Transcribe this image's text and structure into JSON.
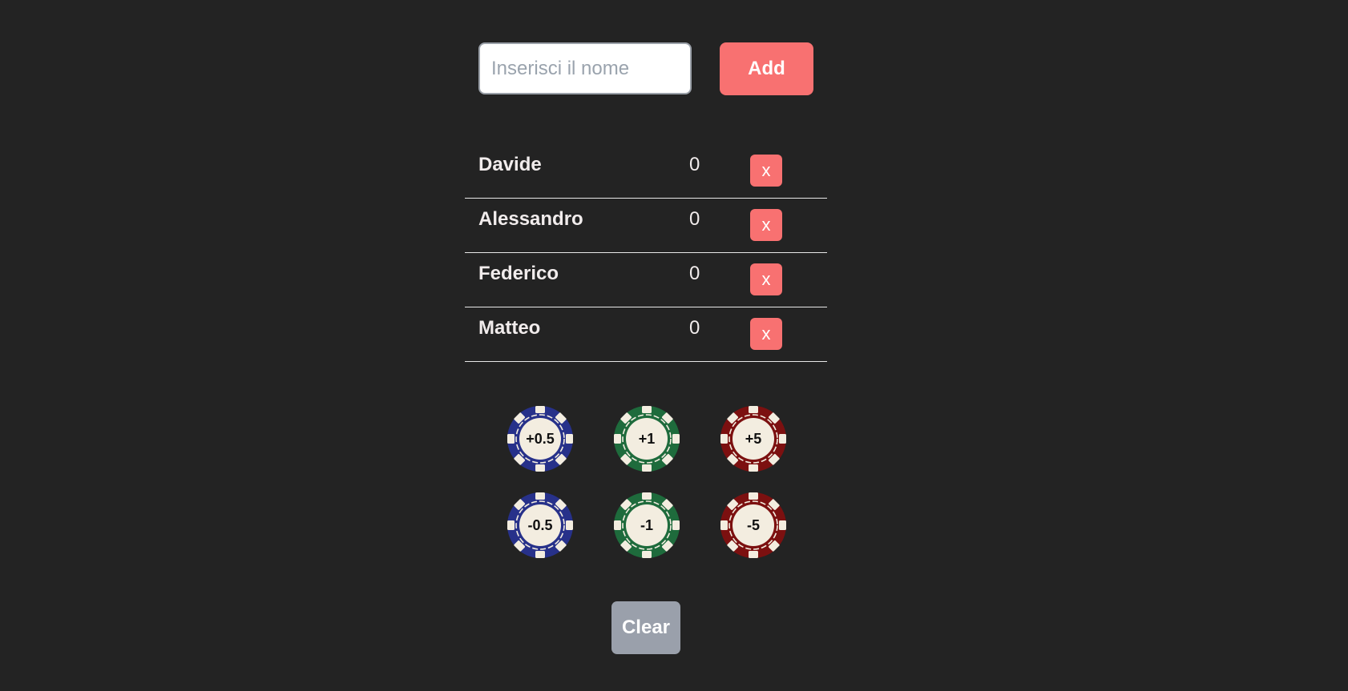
{
  "add_form": {
    "placeholder": "Inserisci il nome",
    "value": "",
    "add_label": "Add"
  },
  "players": [
    {
      "name": "Davide",
      "score": "0",
      "remove_label": "x"
    },
    {
      "name": "Alessandro",
      "score": "0",
      "remove_label": "x"
    },
    {
      "name": "Federico",
      "score": "0",
      "remove_label": "x"
    },
    {
      "name": "Matteo",
      "score": "0",
      "remove_label": "x"
    }
  ],
  "chips": [
    {
      "label": "+0.5",
      "color": "#27318a"
    },
    {
      "label": "+1",
      "color": "#1e6b3c"
    },
    {
      "label": "+5",
      "color": "#7c1010"
    },
    {
      "label": "-0.5",
      "color": "#27318a"
    },
    {
      "label": "-1",
      "color": "#1e6b3c"
    },
    {
      "label": "-5",
      "color": "#7c1010"
    }
  ],
  "clear_label": "Clear",
  "colors": {
    "background": "#232323",
    "accent": "#f87171",
    "neutral_button": "#9aa0ab",
    "chip_face": "#f3ede0"
  }
}
